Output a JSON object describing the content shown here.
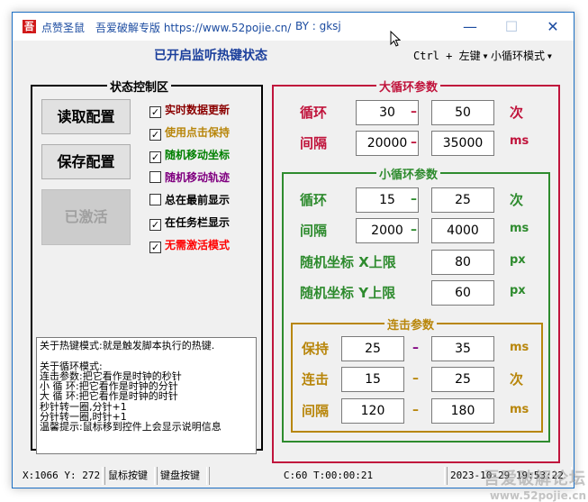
{
  "titlebar": {
    "app_icon_glyph": "吾",
    "app_name": "点赞圣鼠",
    "edition": "吾爱破解专版 https://www.52pojie.cn/",
    "author": "BY : gksj",
    "minimize": "—",
    "maximize": "☐",
    "close": "✕"
  },
  "header": {
    "status_title": "已开启监听热键状态",
    "hotkey_mod": "Ctrl + 左键",
    "hotkey_mode": "小循环模式"
  },
  "control_panel": {
    "title": "状态控制区",
    "buttons": {
      "read": "读取配置",
      "save": "保存配置",
      "activated": "已激活"
    },
    "checkboxes": [
      {
        "label": "实时数据更新",
        "checked": true,
        "color": "#8b0000"
      },
      {
        "label": "使用点击保持",
        "checked": true,
        "color": "#b8860b"
      },
      {
        "label": "随机移动坐标",
        "checked": true,
        "color": "#008000"
      },
      {
        "label": "随机移动轨迹",
        "checked": false,
        "color": "#800080"
      },
      {
        "label": "总在最前显示",
        "checked": false,
        "color": "#000000"
      },
      {
        "label": "在任务栏显示",
        "checked": true,
        "color": "#000000"
      },
      {
        "label": "无需激活模式",
        "checked": true,
        "color": "#ff0000"
      }
    ],
    "info_lines": [
      "关于热键模式:就是触发脚本执行的热键.",
      "",
      "关于循环模式:",
      "连击参数:把它看作是时钟的秒针",
      "小 循 环:把它看作是时钟的分针",
      "大 循 环:把它看作是时钟的时针",
      "秒针转一圈,分针+1",
      "分针转一圈,时针+1",
      "温馨提示:鼠标移到控件上会显示说明信息"
    ]
  },
  "big_loop": {
    "title": "大循环参数",
    "color": "#c0143c",
    "loop": {
      "label": "循环",
      "min": "30",
      "max": "50",
      "unit": "次"
    },
    "interval": {
      "label": "间隔",
      "min": "20000",
      "max": "35000",
      "unit": "ms"
    }
  },
  "small_loop": {
    "title": "小循环参数",
    "color": "#2e8b2e",
    "loop": {
      "label": "循环",
      "min": "15",
      "max": "25",
      "unit": "次"
    },
    "interval": {
      "label": "间隔",
      "min": "2000",
      "max": "4000",
      "unit": "ms"
    },
    "rand_x": {
      "label": "随机坐标  X上限",
      "value": "80",
      "unit": "px"
    },
    "rand_y": {
      "label": "随机坐标  Y上限",
      "value": "60",
      "unit": "px"
    }
  },
  "combo": {
    "title": "连击参数",
    "color": "#b8860b",
    "hold": {
      "label": "保持",
      "min": "25",
      "max": "35",
      "unit": "ms",
      "dash_color": "#800080"
    },
    "click": {
      "label": "连击",
      "min": "15",
      "max": "25",
      "unit": "次"
    },
    "interval": {
      "label": "间隔",
      "min": "120",
      "max": "180",
      "unit": "ms"
    }
  },
  "dash": "–",
  "statusbar": {
    "coords": "X:1066  Y: 272",
    "mouse_keys": "鼠标按键",
    "keyboard_keys": "键盘按键",
    "counter": "C:60  T:00:00:21",
    "datetime": "2023-10-29 19:53:22"
  },
  "watermark": {
    "line1": "吾爱破解论坛",
    "line2": "www.52pojie.cn"
  }
}
